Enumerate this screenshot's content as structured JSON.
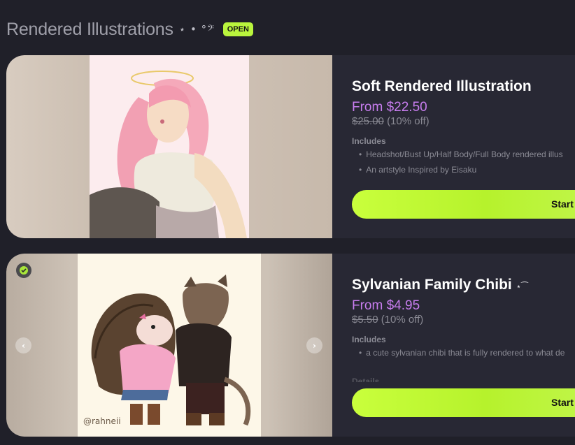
{
  "section": {
    "title": "Rendered Illustrations",
    "decoration": "⋆ • °𝄢",
    "badge": "OPEN"
  },
  "cards": [
    {
      "title": "Soft Rendered Illustration",
      "title_decoration": "",
      "price_from": "From $22.50",
      "original_price": "$25.00",
      "discount": "(10% off)",
      "includes_label": "Includes",
      "includes": [
        "Headshot/Bust Up/Half Body/Full Body rendered illus",
        "An artstyle Inspired by Eisaku"
      ],
      "button_label": "Start"
    },
    {
      "title": "Sylvanian Family Chibi",
      "title_decoration": "⋆⁀",
      "price_from": "From $4.95",
      "original_price": "$5.50",
      "discount": "(10% off)",
      "includes_label": "Includes",
      "includes": [
        "a cute sylvanian chibi that is fully rendered to what de"
      ],
      "details_label": "Details",
      "artist_watermark": "@rahneii",
      "button_label": "Start"
    }
  ],
  "colors": {
    "background": "#202029",
    "card": "#282834",
    "accent_green": "#b9f53d",
    "price_purple": "#c77dee",
    "muted_text": "#8a8a94"
  },
  "icons": [
    "verified-check-icon",
    "chevron-left-icon",
    "chevron-right-icon"
  ]
}
